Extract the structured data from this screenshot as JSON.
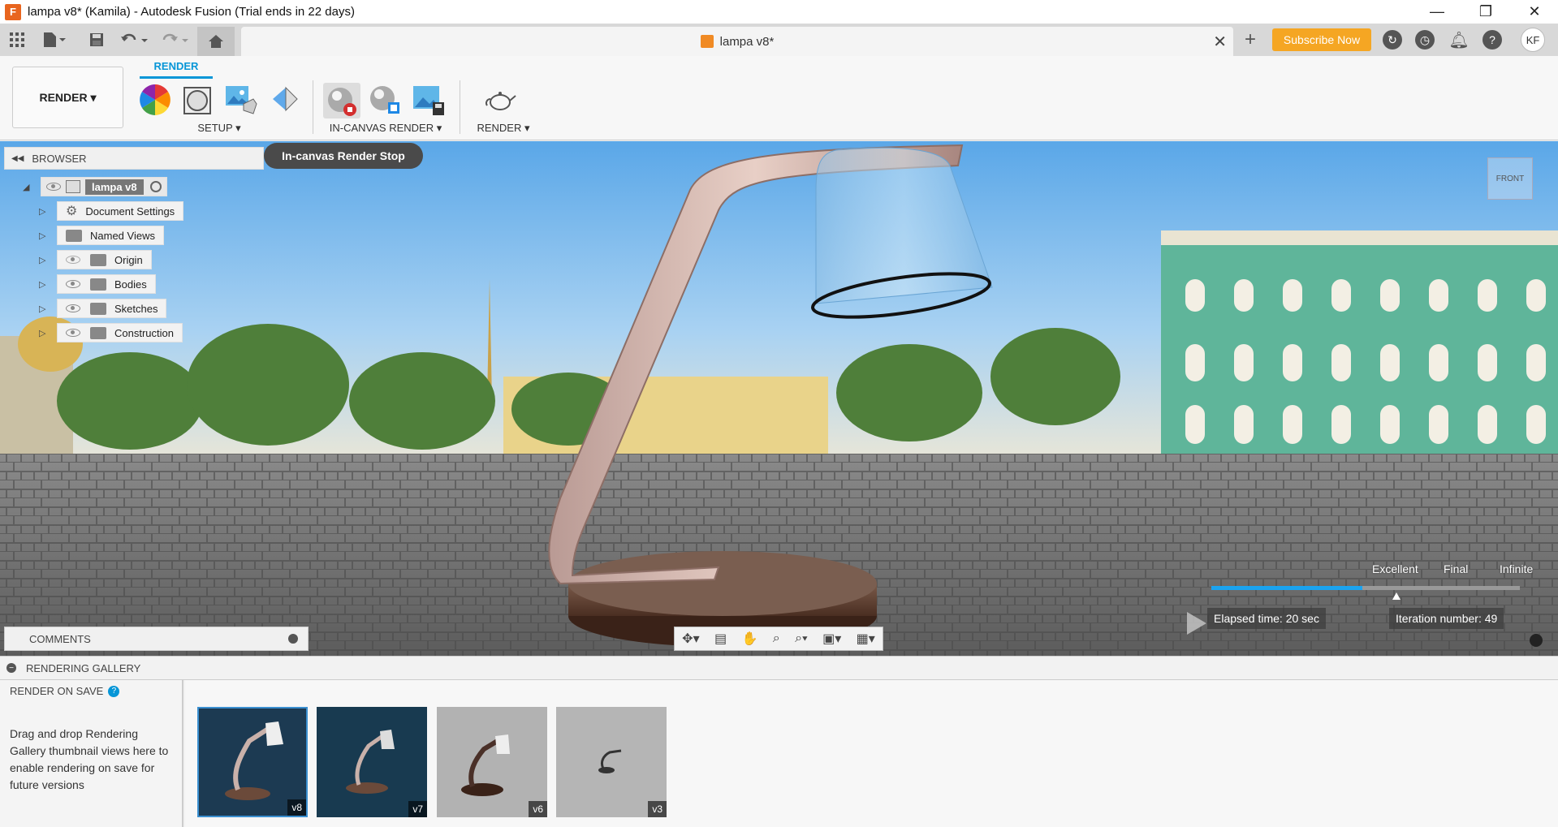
{
  "window": {
    "title": "lampa v8* (Kamila) - Autodesk Fusion (Trial ends in 22 days)",
    "app_icon": "F",
    "minimize": "—",
    "restore": "❐",
    "close": "✕"
  },
  "tabbar": {
    "doc_tab_label": "lampa v8*",
    "close": "✕",
    "add": "+",
    "subscribe_label": "Subscribe Now",
    "avatar_initials": "KF"
  },
  "toolbar": {
    "workspace_label": "RENDER ▾",
    "active_tab": "RENDER",
    "groups": {
      "setup": "SETUP ▾",
      "in_canvas_render": "IN-CANVAS RENDER ▾",
      "render": "RENDER ▾"
    }
  },
  "tooltip": "In-canvas Render Stop",
  "browser": {
    "title": "BROWSER",
    "root": "lampa v8",
    "items": [
      {
        "label": "Document Settings",
        "icon": "gear-icon",
        "visible": null
      },
      {
        "label": "Named Views",
        "icon": "folder-icon",
        "visible": null
      },
      {
        "label": "Origin",
        "icon": "folder-icon",
        "visible": false
      },
      {
        "label": "Bodies",
        "icon": "folder-icon",
        "visible": true
      },
      {
        "label": "Sketches",
        "icon": "folder-icon",
        "visible": true
      },
      {
        "label": "Construction",
        "icon": "folder-icon",
        "visible": true
      }
    ]
  },
  "comments": {
    "title": "COMMENTS"
  },
  "render_status": {
    "quality_excellent": "Excellent",
    "quality_final": "Final",
    "quality_infinite": "Infinite",
    "progress_fraction": 0.49,
    "elapsed": "Elapsed time: 20 sec",
    "iteration": "Iteration number: 49",
    "accent": "#1aa3f0"
  },
  "viewcube": {
    "face": "FRONT"
  },
  "gallery": {
    "title": "RENDERING GALLERY",
    "render_on_save": "RENDER ON SAVE",
    "help": "?",
    "hint": "Drag and drop Rendering Gallery thumbnail views here to enable rendering on save for future versions",
    "thumbnails": [
      {
        "label": "v8",
        "bg": "#1c3a52",
        "selected": true
      },
      {
        "label": "v7",
        "bg": "#183a50",
        "selected": false
      },
      {
        "label": "v6",
        "bg": "#b2b2b2",
        "selected": false
      },
      {
        "label": "v3",
        "bg": "#b5b5b5",
        "selected": false
      }
    ]
  },
  "colors": {
    "brand_orange": "#f5a623",
    "accent_blue": "#0696d7"
  }
}
